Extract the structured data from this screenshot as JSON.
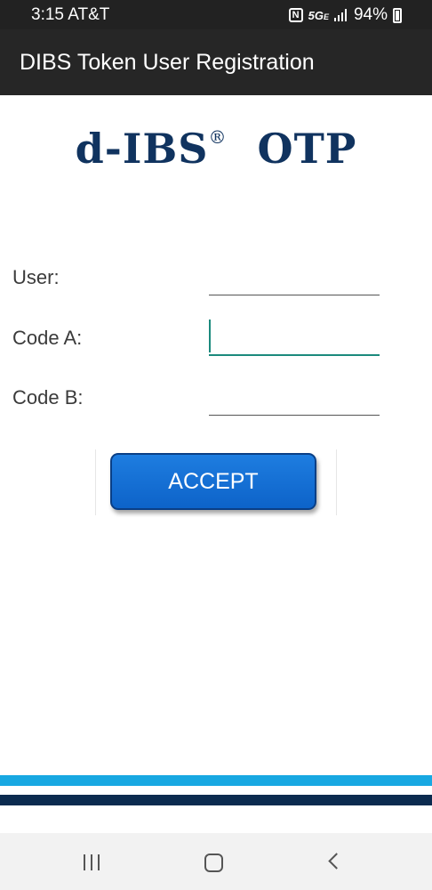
{
  "status_bar": {
    "time": "3:15 AT&T",
    "nfc_icon": "N",
    "network": "5G",
    "network_suffix": "E",
    "battery": "94%"
  },
  "app_bar": {
    "title": "DIBS Token User Registration"
  },
  "logo": {
    "main": "d-IBS",
    "registered": "®",
    "suffix": "OTP",
    "color": "#10335f"
  },
  "form": {
    "user_label": "User:",
    "user_value": "",
    "code_a_label": "Code A:",
    "code_a_value": "",
    "code_b_label": "Code B:",
    "code_b_value": ""
  },
  "accept_button": {
    "label": "ACCEPT",
    "color": "#1372d8"
  },
  "footer": {
    "stripe_light_color": "#18a8e2",
    "stripe_dark_color": "#0b2b4f"
  },
  "nav_bar": {
    "recent_icon": "recent-apps-icon",
    "home_icon": "home-icon",
    "back_icon": "back-icon"
  }
}
